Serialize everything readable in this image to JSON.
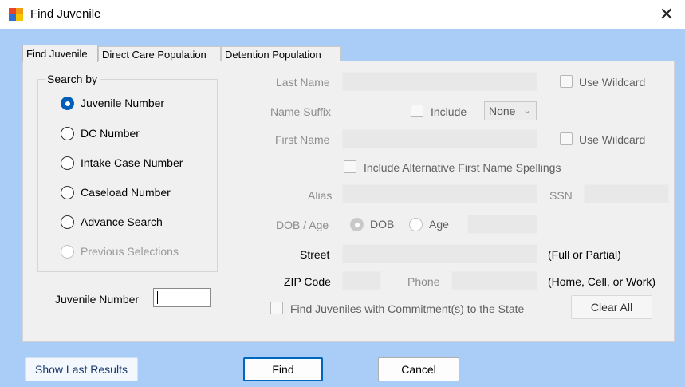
{
  "window": {
    "title": "Find Juvenile",
    "close_glyph": "✕",
    "icon": "app-window-icon"
  },
  "tabs": [
    {
      "label": "Find Juvenile",
      "active": true
    },
    {
      "label": "Direct Care Population",
      "active": false
    },
    {
      "label": "Detention Population",
      "active": false
    }
  ],
  "search_by": {
    "legend": "Search by",
    "options": [
      {
        "label": "Juvenile Number",
        "checked": true,
        "enabled": true
      },
      {
        "label": "DC Number",
        "checked": false,
        "enabled": true
      },
      {
        "label": "Intake Case Number",
        "checked": false,
        "enabled": true
      },
      {
        "label": "Caseload Number",
        "checked": false,
        "enabled": true
      },
      {
        "label": "Advance Search",
        "checked": false,
        "enabled": true
      },
      {
        "label": "Previous Selections",
        "checked": false,
        "enabled": false
      }
    ]
  },
  "juvenile_number": {
    "label": "Juvenile Number",
    "value": ""
  },
  "form": {
    "last_name_label": "Last Name",
    "use_wildcard_label_1": "Use Wildcard",
    "name_suffix_label": "Name Suffix",
    "include_label": "Include",
    "suffix_value": "None",
    "first_name_label": "First Name",
    "use_wildcard_label_2": "Use Wildcard",
    "alt_spellings_label": "Include Alternative First Name Spellings",
    "alias_label": "Alias",
    "ssn_label": "SSN",
    "dob_age_label": "DOB / Age",
    "dob_option": "DOB",
    "age_option": "Age",
    "street_label": "Street",
    "street_hint": "(Full or Partial)",
    "zip_label": "ZIP Code",
    "phone_label": "Phone",
    "phone_hint": "(Home, Cell, or Work)",
    "commitment_label": "Find Juveniles with Commitment(s) to the State",
    "clear_all_label": "Clear All"
  },
  "footer": {
    "show_last_label": "Show Last Results",
    "find_label": "Find",
    "cancel_label": "Cancel"
  },
  "colors": {
    "client_bg": "#a9cdf6",
    "panel_bg": "#f0f0f0",
    "accent": "#005fb8"
  }
}
